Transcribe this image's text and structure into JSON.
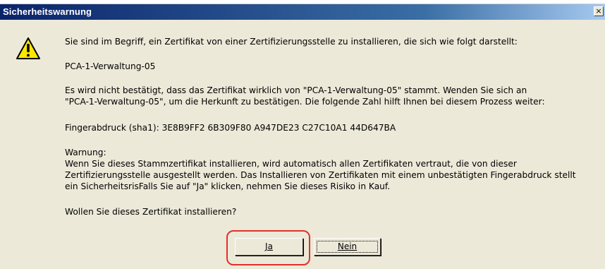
{
  "window": {
    "title": "Sicherheitswarnung",
    "close_glyph": "×"
  },
  "icons": {
    "warning": "warning-triangle-icon",
    "close": "close-icon"
  },
  "message": {
    "intro": "Sie sind im Begriff, ein Zertifikat von einer Zertifizierungsstelle zu installieren, die sich wie folgt darstellt:",
    "ca_name": "PCA-1-Verwaltung-05",
    "verify_line1": "Es wird nicht bestätigt, dass das Zertifikat wirklich von \"PCA-1-Verwaltung-05\" stammt. Wenden Sie sich an",
    "verify_line2": "\"PCA-1-Verwaltung-05\", um die Herkunft zu bestätigen. Die folgende Zahl hilft Ihnen bei diesem Prozess weiter:",
    "fingerprint": "Fingerabdruck (sha1): 3E8B9FF2 6B309F80 A947DE23 C27C10A1 44D647BA",
    "warning_heading": "Warnung:",
    "warning_line1": "Wenn Sie dieses Stammzertifikat installieren, wird automatisch allen Zertifikaten vertraut, die von dieser",
    "warning_line2": "Zertifizierungsstelle ausgestellt werden. Das Installieren von Zertifikaten mit einem unbestätigten Fingerabdruck stellt",
    "warning_line3": "ein SicherheitsrisFalls Sie auf \"Ja\" klicken, nehmen Sie dieses Risiko in Kauf.",
    "question": "Wollen Sie dieses Zertifikat installieren?"
  },
  "buttons": {
    "yes": "Ja",
    "no": "Nein"
  },
  "colors": {
    "highlight": "#e0312d",
    "titlebar": "#0a246a",
    "dialog_bg": "#ece9d8"
  }
}
